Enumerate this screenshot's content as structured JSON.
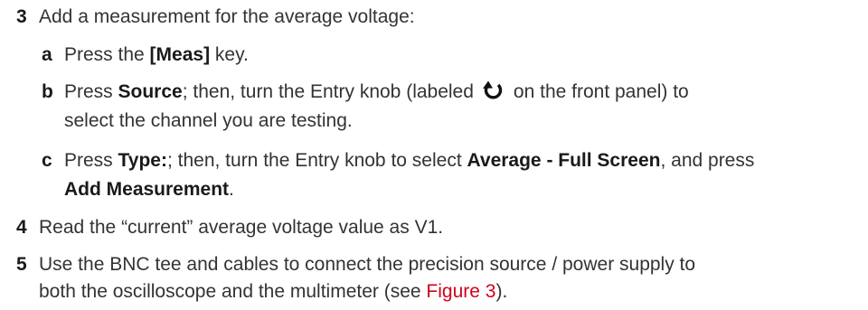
{
  "steps": [
    {
      "num": "3",
      "text": "Add a measurement for the average voltage:",
      "substeps": [
        {
          "letter": "a",
          "pre": "Press the ",
          "bold1": "[Meas]",
          "post": " key."
        },
        {
          "letter": "b",
          "pre": "Press ",
          "bold1": "Source",
          "mid": "; then, turn the Entry knob (labeled",
          "post": "on the front panel) to",
          "line2": "select the channel you are testing.",
          "icon": "entry-knob-icon"
        },
        {
          "letter": "c",
          "pre": "Press ",
          "bold1": "Type:",
          "mid": "; then, turn the Entry knob to select ",
          "bold2": "Average - Full Screen",
          "post": ", and press",
          "line2_bold": "Add Measurement",
          "line2_post": "."
        }
      ]
    },
    {
      "num": "4",
      "text": "Read the “current” average voltage value as V1."
    },
    {
      "num": "5",
      "text": "Use the BNC tee and cables to connect the precision source / power supply to",
      "line2_pre": "both the oscilloscope and the multimeter (see ",
      "line2_link": "Figure 3",
      "line2_post": ")."
    }
  ],
  "colors": {
    "text": "#333333",
    "link": "#d0021b"
  }
}
